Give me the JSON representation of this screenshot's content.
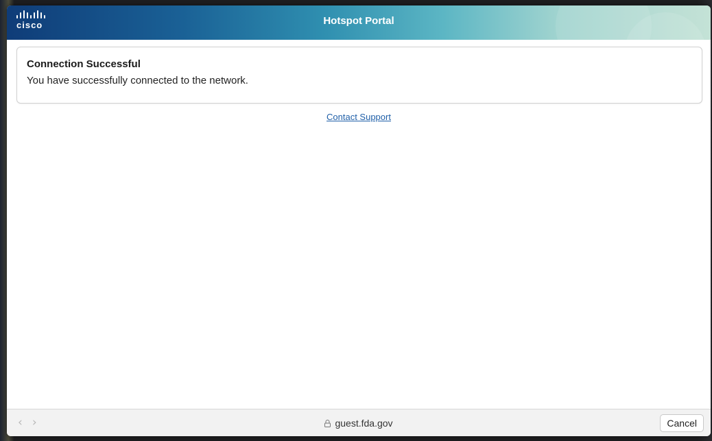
{
  "header": {
    "logo_text": "cisco",
    "title": "Hotspot Portal"
  },
  "card": {
    "heading": "Connection Successful",
    "message": "You have successfully connected to the network."
  },
  "support": {
    "link_text": "Contact Support"
  },
  "bottombar": {
    "back_icon": "chevron-left-icon",
    "forward_icon": "chevron-right-icon",
    "url": "guest.fda.gov",
    "cancel_label": "Cancel"
  },
  "colors": {
    "header_start": "#0f3c78",
    "header_end": "#c4e2d6",
    "link": "#1f5fa8"
  }
}
